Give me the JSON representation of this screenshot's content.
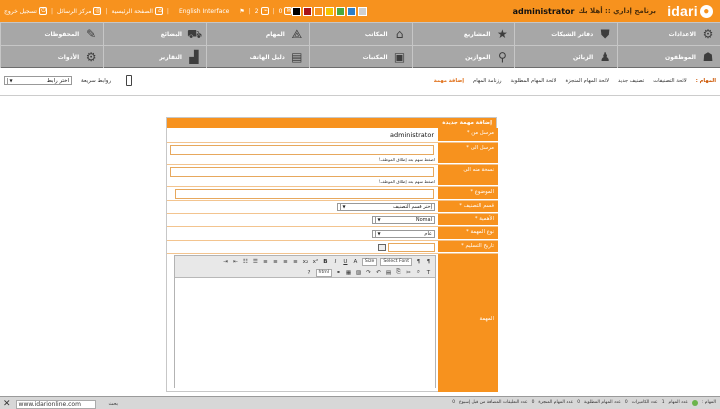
{
  "header": {
    "logo_text": "idari",
    "program_title": "برنامج إداري :: أهلا بك",
    "user_name": "administrator",
    "english_link": "English Interface",
    "home_link": "الصفحة الرئيسية",
    "messages_link": "مركز الرسائل",
    "logout_link": "تسجيل خروج",
    "count_a": "2",
    "count_b": "0",
    "swatches": [
      "#000000",
      "#a8141a",
      "#f7921e",
      "#f3c400",
      "#4aa83c",
      "#2d7fc9",
      "#cfcfcf"
    ]
  },
  "nav": {
    "row1": [
      "الاعدادات",
      "دفاتر الشيكات",
      "المشاريع",
      "المكاتب",
      "المهام",
      "البضائع",
      "المحفوظات"
    ],
    "row2": [
      "الموظفون",
      "الزبائن",
      "الموازين",
      "المكتبات",
      "دليل الهاتف",
      "التقارير",
      "الأدوات"
    ]
  },
  "tabs": {
    "label": "المهام :",
    "items": [
      "لائحة التصنيفات",
      "تصنيف جديد",
      "لائحة المهام المنجزة",
      "لائحة المهام المطلوبة",
      "رزنامة المهام",
      "إضافة مهمة"
    ],
    "active_index": 5
  },
  "quick": {
    "label": "روابط سريعة",
    "select_value": "اختر رابط"
  },
  "form": {
    "title": "إضافة مهمة جديدة",
    "fields": {
      "from_label": "مرسل من *",
      "from_value": "administrator",
      "to_label": "مرسل الى *",
      "cc_label": "نسخة منه الى",
      "hint": "اضغط سهم بعد إطلاق الموظف!",
      "subject_label": "الموضوع *",
      "category_label": "قسم التصنيف *",
      "category_value": "إختر قسم التصنيف",
      "priority_label": "الأهمية *",
      "priority_value": "Nomal",
      "type_label": "نوع المهمة *",
      "type_value": "عام",
      "due_label": "تاريخ التسليم *",
      "task_label": "المهمة"
    }
  },
  "editor": {
    "style_select": "Size",
    "font_select": "Select Font",
    "font_select_b": "html"
  },
  "status": {
    "label": "المهام :",
    "items": [
      "عدد المهام",
      "عدد الكاميرات",
      "عدد المهام المطلوبة",
      "عدد المهام المنجزة",
      "عدد التعليقات المضافة من قبل إسبوع"
    ],
    "values": [
      "1",
      "0",
      "0",
      "0",
      "0"
    ]
  },
  "footer": {
    "url": "www.idarionline.com",
    "search_label": "بحث"
  }
}
